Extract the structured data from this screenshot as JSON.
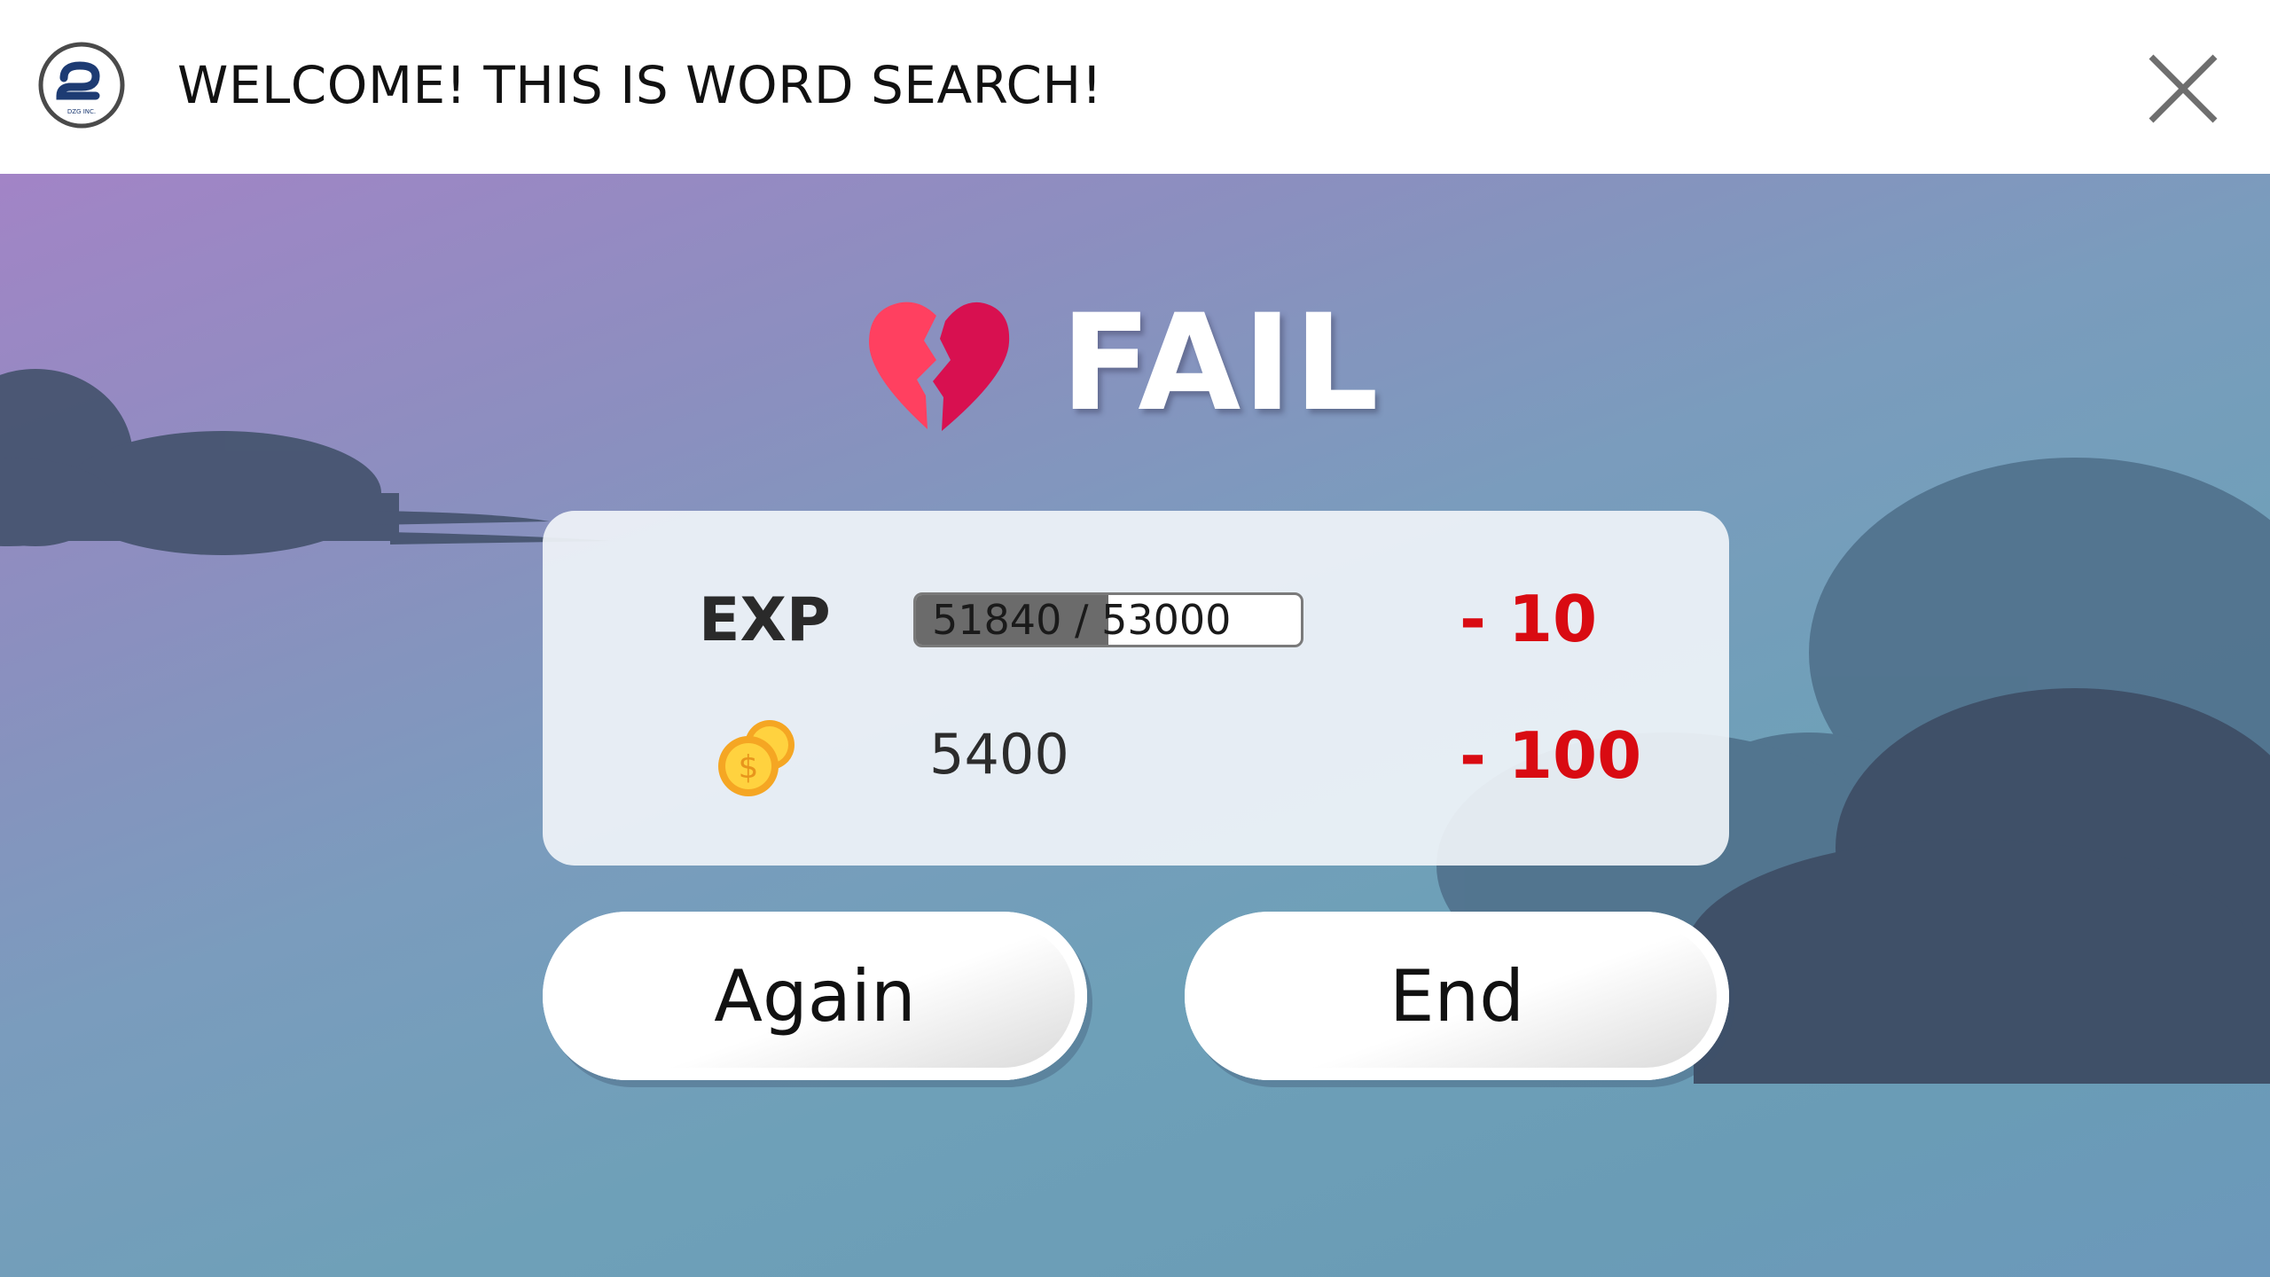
{
  "header": {
    "title": "WELCOME! THIS IS WORD SEARCH!",
    "logo_text": "DZG INC.",
    "close_icon": "close-icon"
  },
  "result": {
    "title": "FAIL",
    "icon": "broken-heart-icon"
  },
  "panel": {
    "exp": {
      "label": "EXP",
      "current": 51840,
      "max": 53000,
      "display": "51840 / 53000",
      "progress_fraction": 0.5,
      "change": "- 10"
    },
    "coins": {
      "icon": "coins-icon",
      "value": "5400",
      "change": "- 100"
    }
  },
  "buttons": {
    "again_label": "Again",
    "end_label": "End"
  },
  "colors": {
    "penalty": "#d90b12",
    "heart_left": "#ff4060",
    "heart_right": "#d81050",
    "cloud_dark": "#3f5068"
  }
}
